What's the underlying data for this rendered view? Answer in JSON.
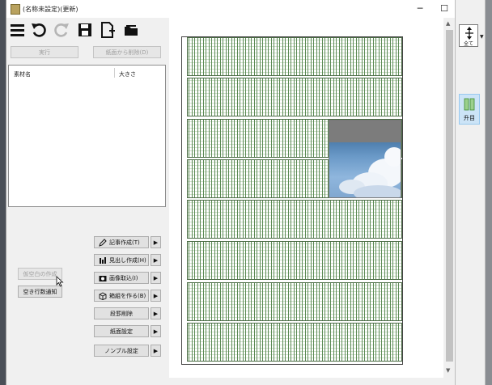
{
  "window": {
    "title": "(名称未設定)(更新)",
    "minimize_glyph": "─",
    "maximize_glyph": "☐",
    "close_glyph": "✕"
  },
  "toolbar": {
    "icons": [
      "menu-icon",
      "undo-icon",
      "redo-icon",
      "save-icon",
      "new-document-icon",
      "open-folder-icon"
    ]
  },
  "buttons": {
    "execute": "実行",
    "remove_from_page": "紙面から削除(D)"
  },
  "material_table": {
    "columns": [
      "素材名",
      "大きさ"
    ],
    "rows": []
  },
  "actions": [
    {
      "label": "記事作成(T)",
      "icon": "pencil-icon"
    },
    {
      "label": "見出し作成(H)",
      "icon": "headline-icon"
    },
    {
      "label": "画像取込(I)",
      "icon": "camera-icon"
    },
    {
      "label": "箱組を作る(B)",
      "icon": "box-icon"
    },
    {
      "label": "段罫削除",
      "icon": ""
    },
    {
      "label": "紙面設定",
      "icon": ""
    },
    {
      "label": "ノンブル設定",
      "icon": ""
    }
  ],
  "arrow_glyph": "▶",
  "blank_buttons": {
    "create_blank": "仮空白の作成",
    "blank_line_notify": "空き行数通知"
  },
  "side_panel": {
    "all_label": "全て",
    "column_label": "升目"
  },
  "colors": {
    "grid_green": "#5c8a55",
    "selected_tool_bg": "#cce4f7"
  }
}
